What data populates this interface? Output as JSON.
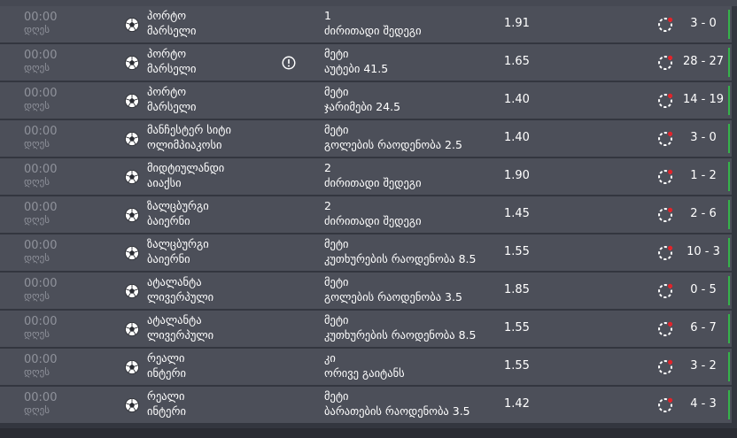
{
  "colors": {
    "row_background": "#4c4f59",
    "page_background": "#33363f",
    "muted_text": "#8f929b",
    "text": "#ffffff",
    "status_accent_red": "#e0242b",
    "won_indicator_green": "#35b34a"
  },
  "rows": [
    {
      "time": "00:00",
      "day": "დღეს",
      "sport_icon": "soccer-ball-icon",
      "team1": "პორტო",
      "team2": "მარსელი",
      "info_icon": false,
      "pick": "1",
      "market": "ძირითადი შედეგი",
      "odds": "1.91",
      "status_icon": "live-status-icon",
      "score": "3 - 0"
    },
    {
      "time": "00:00",
      "day": "დღეს",
      "sport_icon": "soccer-ball-icon",
      "team1": "პორტო",
      "team2": "მარსელი",
      "info_icon": true,
      "pick": "მეტი",
      "market": "აუტები 41.5",
      "odds": "1.65",
      "status_icon": "live-status-icon",
      "score": "28 - 27"
    },
    {
      "time": "00:00",
      "day": "დღეს",
      "sport_icon": "soccer-ball-icon",
      "team1": "პორტო",
      "team2": "მარსელი",
      "info_icon": false,
      "pick": "მეტი",
      "market": "ჯარიმები 24.5",
      "odds": "1.40",
      "status_icon": "live-status-icon",
      "score": "14 - 19"
    },
    {
      "time": "00:00",
      "day": "დღეს",
      "sport_icon": "soccer-ball-icon",
      "team1": "მანჩესტერ სიტი",
      "team2": "ოლიმპიაკოსი",
      "info_icon": false,
      "pick": "მეტი",
      "market": "გოლების რაოდენობა 2.5",
      "odds": "1.40",
      "status_icon": "live-status-icon",
      "score": "3 - 0"
    },
    {
      "time": "00:00",
      "day": "დღეს",
      "sport_icon": "soccer-ball-icon",
      "team1": "მიდტიულანდი",
      "team2": "აიაქსი",
      "info_icon": false,
      "pick": "2",
      "market": "ძირითადი შედეგი",
      "odds": "1.90",
      "status_icon": "live-status-icon",
      "score": "1 - 2"
    },
    {
      "time": "00:00",
      "day": "დღეს",
      "sport_icon": "soccer-ball-icon",
      "team1": "ზალცბურგი",
      "team2": "ბაიერნი",
      "info_icon": false,
      "pick": "2",
      "market": "ძირითადი შედეგი",
      "odds": "1.45",
      "status_icon": "live-status-icon",
      "score": "2 - 6"
    },
    {
      "time": "00:00",
      "day": "დღეს",
      "sport_icon": "soccer-ball-icon",
      "team1": "ზალცბურგი",
      "team2": "ბაიერნი",
      "info_icon": false,
      "pick": "მეტი",
      "market": "კუთხურების რაოდენობა 8.5",
      "odds": "1.55",
      "status_icon": "live-status-icon",
      "score": "10 - 3"
    },
    {
      "time": "00:00",
      "day": "დღეს",
      "sport_icon": "soccer-ball-icon",
      "team1": "ატალანტა",
      "team2": "ლივერპული",
      "info_icon": false,
      "pick": "მეტი",
      "market": "გოლების რაოდენობა 3.5",
      "odds": "1.85",
      "status_icon": "live-status-icon",
      "score": "0 - 5"
    },
    {
      "time": "00:00",
      "day": "დღეს",
      "sport_icon": "soccer-ball-icon",
      "team1": "ატალანტა",
      "team2": "ლივერპული",
      "info_icon": false,
      "pick": "მეტი",
      "market": "კუთხურების რაოდენობა 8.5",
      "odds": "1.55",
      "status_icon": "live-status-icon",
      "score": "6 - 7"
    },
    {
      "time": "00:00",
      "day": "დღეს",
      "sport_icon": "soccer-ball-icon",
      "team1": "რეალი",
      "team2": "ინტერი",
      "info_icon": false,
      "pick": "კი",
      "market": "ორივე გაიტანს",
      "odds": "1.55",
      "status_icon": "live-status-icon",
      "score": "3 - 2"
    },
    {
      "time": "00:00",
      "day": "დღეს",
      "sport_icon": "soccer-ball-icon",
      "team1": "რეალი",
      "team2": "ინტერი",
      "info_icon": false,
      "pick": "მეტი",
      "market": "ბარათების რაოდენობა 3.5",
      "odds": "1.42",
      "status_icon": "live-status-icon",
      "score": "4 - 3"
    }
  ]
}
